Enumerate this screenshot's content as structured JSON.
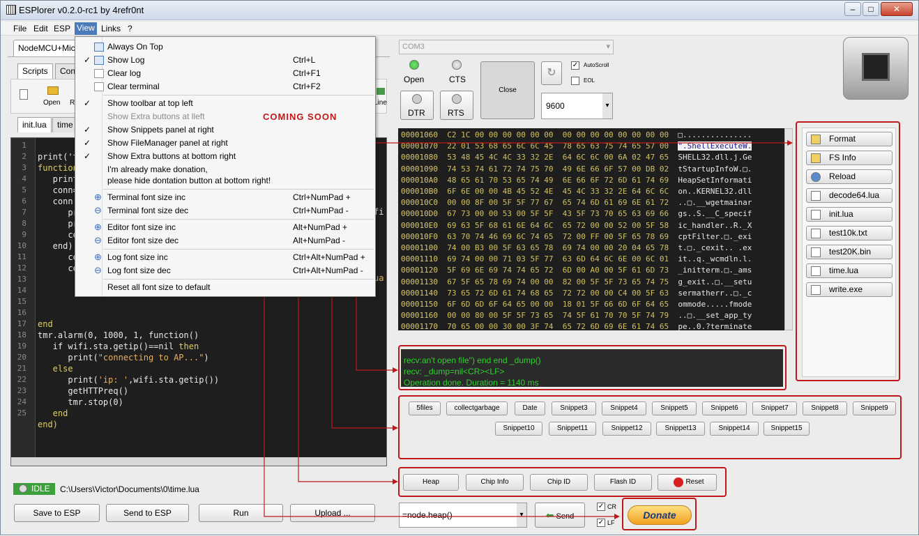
{
  "window": {
    "title": "ESPlorer v0.2.0-rc1 by 4refr0nt"
  },
  "menu": [
    "File",
    "Edit",
    "ESP",
    "View",
    "Links",
    "?"
  ],
  "device_tab": "NodeMCU+Mic",
  "tabs": {
    "scripts": "Scripts",
    "commands": "Con"
  },
  "toolbar": {
    "open": "Open",
    "reload": "R",
    "line": "Line"
  },
  "file_tabs": [
    "init.lua",
    "time"
  ],
  "line_numbers": [
    "1",
    "2",
    "3",
    "4",
    "5",
    "6",
    "7",
    "8",
    "9",
    "10",
    "11",
    "12",
    "13",
    "14",
    "15",
    "16",
    "17",
    "18",
    "19",
    "20",
    "21",
    "22",
    "23",
    "24",
    "25"
  ],
  "code": {
    "l1": "print('t",
    "l2": "function",
    "l3": "   print",
    "l4": "   conn=",
    "l5": "   conn:",
    "l6": "      pri",
    "l7": "      pri",
    "l8": "      con",
    "l9": "   end)",
    "l10": "      con",
    "l11": "      cor",
    "l16": "end",
    "l17": "tmr.alarm(0, 1000, 1, function()",
    "l18a": "   if wifi.sta.getip()==nil ",
    "l18b": "then",
    "l19a": "      print(",
    "l19b": "\"connecting to AP...\"",
    "l19c": ")",
    "l20": "   else",
    "l21a": "      print(",
    "l21b": "'ip: '",
    "l21c": ",wifi.sta.getip())",
    "l22": "      getHTTPreq()",
    "l23": "      tmr.stop(0)",
    "l24": "   end",
    "l25": "end)",
    "fragment_fi": "fi",
    "fragment_ua": "ua"
  },
  "view_menu": {
    "always_on_top": "Always On Top",
    "show_log": "Show Log",
    "show_log_acc": "Ctrl+L",
    "clear_log": "Clear log",
    "clear_log_acc": "Ctrl+F1",
    "clear_terminal": "Clear terminal",
    "clear_terminal_acc": "Ctrl+F2",
    "show_toolbar": "Show toolbar at top left",
    "show_extra_left": "Show Extra buttons at lleft",
    "show_snippets": "Show Snippets panel at right",
    "show_fm": "Show FileManager panel at right",
    "show_extra_bottom": "Show Extra buttons at bottom right",
    "donation_1": "I'm already make donation,",
    "donation_2": "please hide dontation button at bottom right!",
    "term_inc": "Terminal font size inc",
    "term_inc_acc": "Ctrl+NumPad +",
    "term_dec": "Terminal font size dec",
    "term_dec_acc": "Ctrl+NumPad -",
    "editor_inc": "Editor font size inc",
    "editor_inc_acc": "Alt+NumPad +",
    "editor_dec": "Editor font size dec",
    "editor_dec_acc": "Alt+NumPad -",
    "log_inc": "Log font size inc",
    "log_inc_acc": "Ctrl+Alt+NumPad +",
    "log_dec": "Log font size dec",
    "log_dec_acc": "Ctrl+Alt+NumPad -",
    "reset_font": "Reset all font size to default"
  },
  "annotation": "COMING SOON",
  "status": {
    "state": "IDLE",
    "path": "C:\\Users\\Victor\\Documents\\0\\time.lua"
  },
  "bottom_buttons": {
    "save": "Save to ESP",
    "send": "Send to ESP",
    "run": "Run",
    "upload": "Upload ..."
  },
  "port": {
    "selected": "COM3",
    "open": "Open",
    "cts": "CTS",
    "dtr": "DTR",
    "rts": "RTS",
    "close": "Close",
    "baud": "9600",
    "autoscroll": "AutoScroll",
    "eol": "EOL"
  },
  "hex_rows": [
    {
      "off": "00001060",
      "hex": "C2 1C 00 00 00 00 00 00  00 00 00 00 00 00 00 00",
      "txt": "□..............."
    },
    {
      "off": "00001070",
      "hex": "22 01 53 68 65 6C 6C 45  78 65 63 75 74 65 57 00",
      "txt": "\".ShellExecuteW."
    },
    {
      "off": "00001080",
      "hex": "53 48 45 4C 4C 33 32 2E  64 6C 6C 00 6A 02 47 65",
      "txt": "SHELL32.dll.j.Ge"
    },
    {
      "off": "00001090",
      "hex": "74 53 74 61 72 74 75 70  49 6E 66 6F 57 00 DB 02",
      "txt": "tStartupInfoW.□."
    },
    {
      "off": "000010A0",
      "hex": "48 65 61 70 53 65 74 49  6E 66 6F 72 6D 61 74 69",
      "txt": "HeapSetInformati"
    },
    {
      "off": "000010B0",
      "hex": "6F 6E 00 00 4B 45 52 4E  45 4C 33 32 2E 64 6C 6C",
      "txt": "on..KERNEL32.dll"
    },
    {
      "off": "000010C0",
      "hex": "00 00 8F 00 5F 5F 77 67  65 74 6D 61 69 6E 61 72",
      "txt": "..□.__wgetmainar"
    },
    {
      "off": "000010D0",
      "hex": "67 73 00 00 53 00 5F 5F  43 5F 73 70 65 63 69 66",
      "txt": "gs..S.__C_specif"
    },
    {
      "off": "000010E0",
      "hex": "69 63 5F 68 61 6E 64 6C  65 72 00 00 52 00 5F 58",
      "txt": "ic_handler..R._X"
    },
    {
      "off": "000010F0",
      "hex": "63 70 74 46 69 6C 74 65  72 00 FF 00 5F 65 78 69",
      "txt": "cptFilter.□._exi"
    },
    {
      "off": "00001100",
      "hex": "74 00 B3 00 5F 63 65 78  69 74 00 00 20 04 65 78",
      "txt": "t.□._cexit.. .ex"
    },
    {
      "off": "00001110",
      "hex": "69 74 00 00 71 03 5F 77  63 6D 64 6C 6E 00 6C 01",
      "txt": "it..q._wcmdln.l."
    },
    {
      "off": "00001120",
      "hex": "5F 69 6E 69 74 74 65 72  6D 00 A0 00 5F 61 6D 73",
      "txt": "_initterm.□._ams"
    },
    {
      "off": "00001130",
      "hex": "67 5F 65 78 69 74 00 00  82 00 5F 5F 73 65 74 75",
      "txt": "g_exit..□.__setu"
    },
    {
      "off": "00001140",
      "hex": "73 65 72 6D 61 74 68 65  72 72 00 00 C4 00 5F 63",
      "txt": "sermatherr..□._c"
    },
    {
      "off": "00001150",
      "hex": "6F 6D 6D 6F 64 65 00 00  18 01 5F 66 6D 6F 64 65",
      "txt": "ommode.....fmode"
    },
    {
      "off": "00001160",
      "hex": "00 00 80 00 5F 5F 73 65  74 5F 61 70 70 5F 74 79",
      "txt": "..□.__set_app_ty"
    },
    {
      "off": "00001170",
      "hex": "70 65 00 00 30 00 3F 74  65 72 6D 69 6E 61 74 65",
      "txt": "pe..0.?terminate"
    }
  ],
  "terminal": {
    "line1": "recv:an't open file\") end end _dump()",
    "line2": "recv: _dump=nil<CR><LF>",
    "line3": "Operation done. Duration = 1140 ms"
  },
  "fm_buttons": [
    "Format",
    "FS Info",
    "Reload",
    "decode64.lua",
    "init.lua",
    "test10k.txt",
    "test20K.bin",
    "time.lua",
    "write.exe"
  ],
  "snippets_row1": [
    "5files",
    "collectgarbage",
    "Date",
    "Snippet3",
    "Snippet4",
    "Snippet5",
    "Snippet6",
    "Snippet7",
    "Snippet8",
    "Snippet9"
  ],
  "snippets_row2": [
    "Snippet10",
    "Snippet11",
    "Snippet12",
    "Snippet13",
    "Snippet14",
    "Snippet15"
  ],
  "extra_buttons": [
    "Heap",
    "Chip Info",
    "Chip ID",
    "Flash ID",
    "Reset"
  ],
  "command": {
    "value": "=node.heap()",
    "send": "Send",
    "cr": "CR",
    "lf": "LF"
  },
  "donate": "Donate",
  "colors": {
    "accent_red": "#c0181a",
    "led_green": "#2fbf2f",
    "terminal_green": "#2fd12f"
  }
}
